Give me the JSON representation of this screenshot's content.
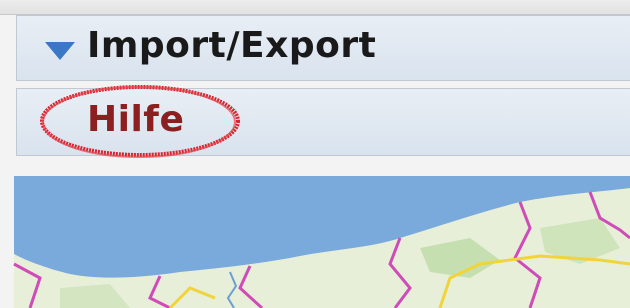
{
  "sidebar": {
    "sections": [
      {
        "label": "Import/Export",
        "icon": "triangle-down-icon",
        "expanded": true
      },
      {
        "label": "Hilfe",
        "highlighted": true
      }
    ]
  },
  "map": {
    "water_color": "#7aa9db",
    "land_color": "#e7efd9",
    "boundary_color": "#cf4bb8",
    "road_color": "#f0d43a"
  },
  "colors": {
    "expand_icon": "#3a78c6",
    "hilfe_label": "#8c2020",
    "highlight_ring": "#d9232f"
  }
}
